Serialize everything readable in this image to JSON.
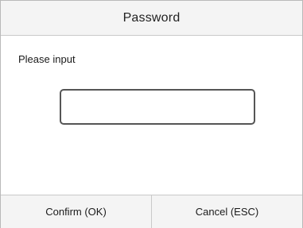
{
  "dialog": {
    "title": "Password",
    "prompt": "Please input",
    "input": {
      "value": "",
      "placeholder": ""
    },
    "buttons": {
      "confirm_label": "Confirm (OK)",
      "cancel_label": "Cancel (ESC)"
    }
  },
  "colors": {
    "title_bar_bg": "#f4f4f4",
    "button_bar_bg": "#f4f4f4",
    "border": "#c9c9c9",
    "input_border": "#555555"
  }
}
